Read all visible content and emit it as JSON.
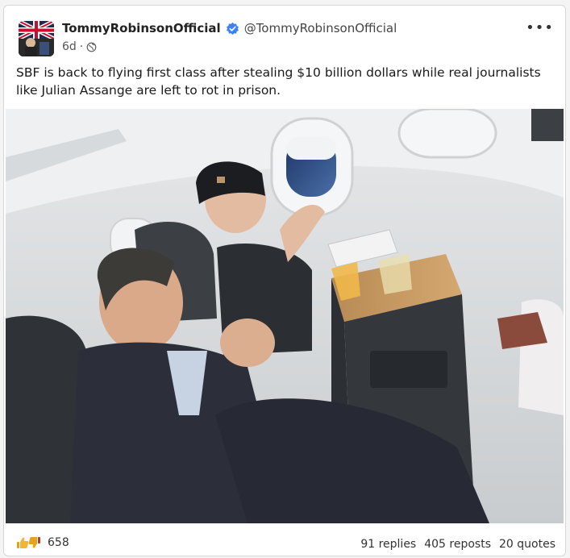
{
  "post": {
    "display_name": "TommyRobinsonOfficial",
    "handle": "@TommyRobinsonOfficial",
    "age": "6d",
    "separator": "·",
    "text": "SBF is back to flying first class after stealing $10 billion dollars while real journalists like Julian Assange are left to rot in prison.",
    "more_label": "•••",
    "visibility_icon": "globe-icon",
    "verified_icon": "verified-badge-icon",
    "accent_color": "#3b82f6"
  },
  "footer": {
    "reaction_icons": [
      "thumbs-up-icon",
      "thumbs-down-icon"
    ],
    "reaction_count": "658",
    "replies": "91 replies",
    "reposts": "405 reposts",
    "quotes": "20 quotes"
  }
}
